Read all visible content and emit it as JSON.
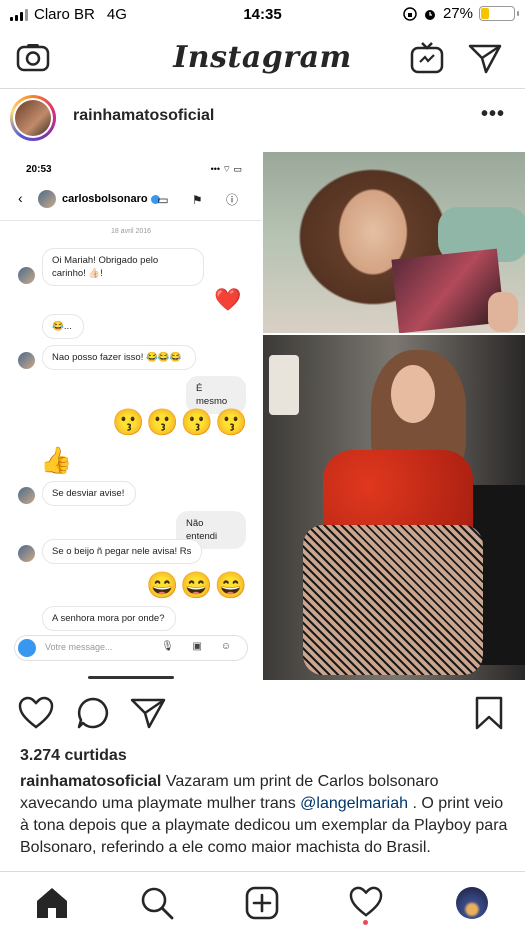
{
  "status_bar": {
    "carrier": "Claro BR",
    "network": "4G",
    "time": "14:35",
    "battery_percent": "27%",
    "battery_level": 0.27,
    "battery_color": "#f5c600"
  },
  "top_nav": {
    "logo": "Instagram",
    "camera_icon": "camera-icon",
    "igtv_icon": "igtv-icon",
    "direct_icon": "paper-plane-icon"
  },
  "post": {
    "username": "rainhamatosoficial",
    "more_icon": "more-horizontal-icon",
    "more_label": "•••",
    "chat_screenshot": {
      "time": "20:53",
      "status": "•••  ⌔ ▭",
      "contact": "carlosbolsonaro",
      "back": "‹",
      "header_icons": "▭ ⚑ ⓘ",
      "date": "18 avril 2016",
      "messages": [
        {
          "from": "them",
          "text": "Oi Mariah! Obrigado pelo carinho! 👍🏻!"
        },
        {
          "from": "me",
          "text": "❤️"
        },
        {
          "from": "them",
          "text": "😂..."
        },
        {
          "from": "them",
          "text": "Nao posso fazer isso! 😂😂😂"
        },
        {
          "from": "me",
          "text": "É mesmo"
        },
        {
          "from": "me",
          "text": "😗😗😗😗"
        },
        {
          "from": "them",
          "text": "👍"
        },
        {
          "from": "them",
          "text": "Se desviar avise!"
        },
        {
          "from": "me",
          "text": "Não entendi"
        },
        {
          "from": "them",
          "text": "Se o beijo ñ pegar nele avisa! Rs"
        },
        {
          "from": "me",
          "text": "😄😄😄"
        },
        {
          "from": "them",
          "text": "A senhora mora por onde?"
        }
      ],
      "input_placeholder": "Votre message...",
      "input_tools": "🎙 ▣ ☺"
    },
    "likes": "3.274 curtidas",
    "caption_user": "rainhamatosoficial",
    "caption_part1": "Vazaram um print de Carlos bolsonaro xavecando uma playmate mulher trans",
    "caption_mention": "@langelmariah",
    "caption_part2": ". O print veio à tona depois que a playmate dedicou um exemplar da Playboy para Bolsonaro, referindo a ele como maior machista do Brasil."
  },
  "actions": {
    "like_icon": "heart-icon",
    "comment_icon": "comment-icon",
    "share_icon": "paper-plane-icon",
    "save_icon": "bookmark-icon"
  },
  "bottom_nav": {
    "home_icon": "home-icon",
    "search_icon": "search-icon",
    "add_icon": "plus-square-icon",
    "activity_icon": "heart-icon",
    "profile_icon": "profile-avatar"
  }
}
